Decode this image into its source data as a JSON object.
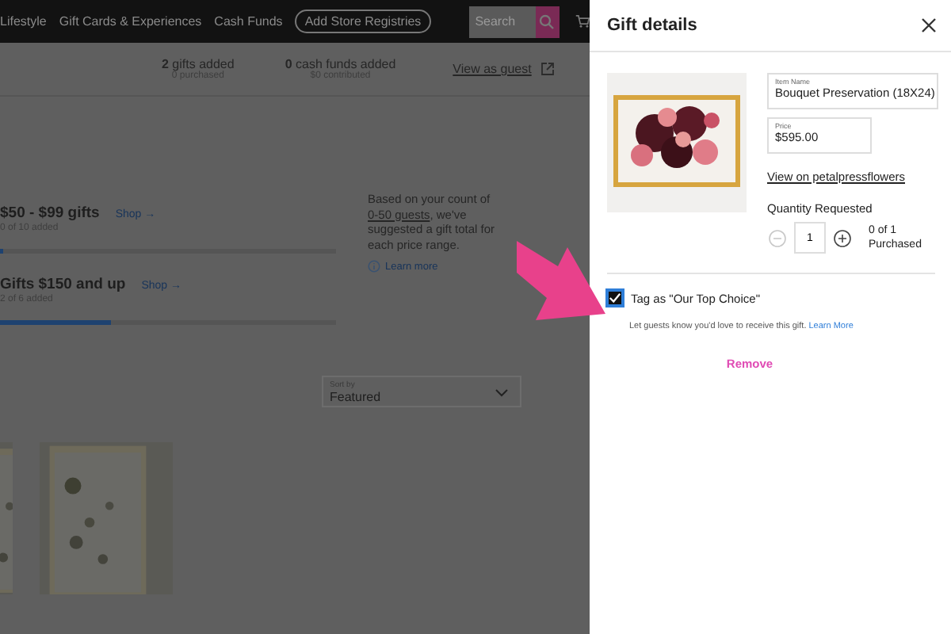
{
  "nav": {
    "links": [
      "Lifestyle",
      "Gift Cards & Experiences",
      "Cash Funds"
    ],
    "button": "Add Store Registries",
    "search": {
      "placeholder": "Search"
    }
  },
  "stats": [
    {
      "value": "2",
      "label": "gifts added",
      "sub": "0 purchased"
    },
    {
      "value": "0",
      "label": "cash funds added",
      "sub": "$0 contributed"
    }
  ],
  "guest_link": "View as guest",
  "tiers": [
    {
      "title": "$50 - $99 gifts",
      "shop": "Shop →",
      "count": "0 of 10 added",
      "level": 0
    },
    {
      "title": "Gifts $150 and up",
      "shop": "Shop →",
      "count": "2 of 6 added",
      "level": 0.33
    }
  ],
  "suggestion": {
    "before": "Based on your count of",
    "link": "0-50 guests",
    "after": ", we've suggested a gift total for each price range.",
    "learn_more": "Learn more"
  },
  "sort": {
    "label": "Sort by",
    "value": "Featured"
  },
  "panel": {
    "title": "Gift details",
    "item_name": {
      "label": "Item Name",
      "value": "Bouquet Preservation (18X24)"
    },
    "price": {
      "label": "Price",
      "value": "$595.00"
    },
    "view_link": "View on petalpressflowers",
    "quantity": {
      "label": "Quantity Requested",
      "value": "1",
      "decrease_disabled": true,
      "purchased": "0 of 1 Purchased"
    },
    "top_choice": {
      "label": "Tag as \"Our Top Choice\"",
      "checked": true,
      "hint": "Let guests know you'd love to receive this gift.",
      "link": "Learn More"
    },
    "remove": "Remove"
  }
}
